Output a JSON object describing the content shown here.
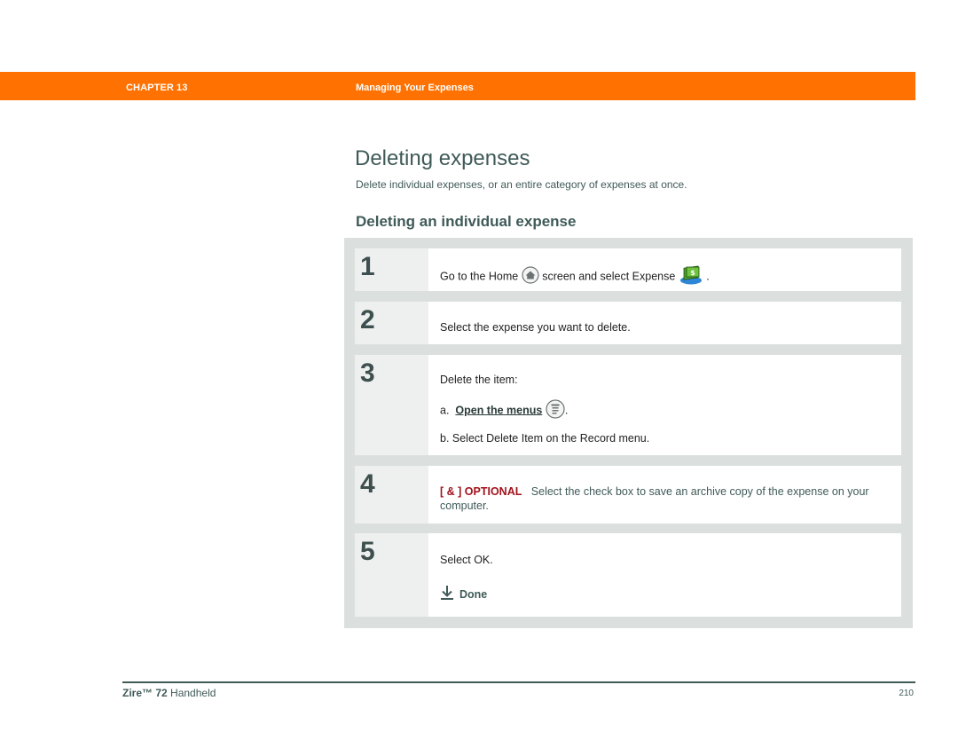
{
  "header": {
    "chapter": "CHAPTER 13",
    "chapter_title": "Managing Your Expenses",
    "accent_color": "#ff7100"
  },
  "page": {
    "title": "Deleting expenses",
    "intro": "Delete individual expenses, or an entire category of expenses at once.",
    "section_title": "Deleting an individual expense"
  },
  "steps": [
    {
      "number": "1",
      "text_before": "Go to the Home",
      "icon1": "home-icon",
      "text_middle": "screen and select Expense",
      "icon2": "expense-app-icon",
      "text_after": "."
    },
    {
      "number": "2",
      "text": "Select the expense you want to delete."
    },
    {
      "number": "3",
      "text": "Delete the item:",
      "sub_a_prefix": "a.",
      "sub_a_link": "Open the menus",
      "sub_a_icon": "menu-icon",
      "sub_a_suffix": ".",
      "sub_b": "b.  Select Delete Item on the Record menu."
    },
    {
      "number": "4",
      "optional_label": "[ & ]  OPTIONAL",
      "text": "Select the check box to save an archive copy of the expense on your computer."
    },
    {
      "number": "5",
      "text": "Select OK.",
      "done_icon": "done-arrow-icon",
      "done_label": "Done"
    }
  ],
  "footer": {
    "product_name": "Zire™ 72",
    "product_suffix": "Handheld",
    "page_number": "210"
  }
}
